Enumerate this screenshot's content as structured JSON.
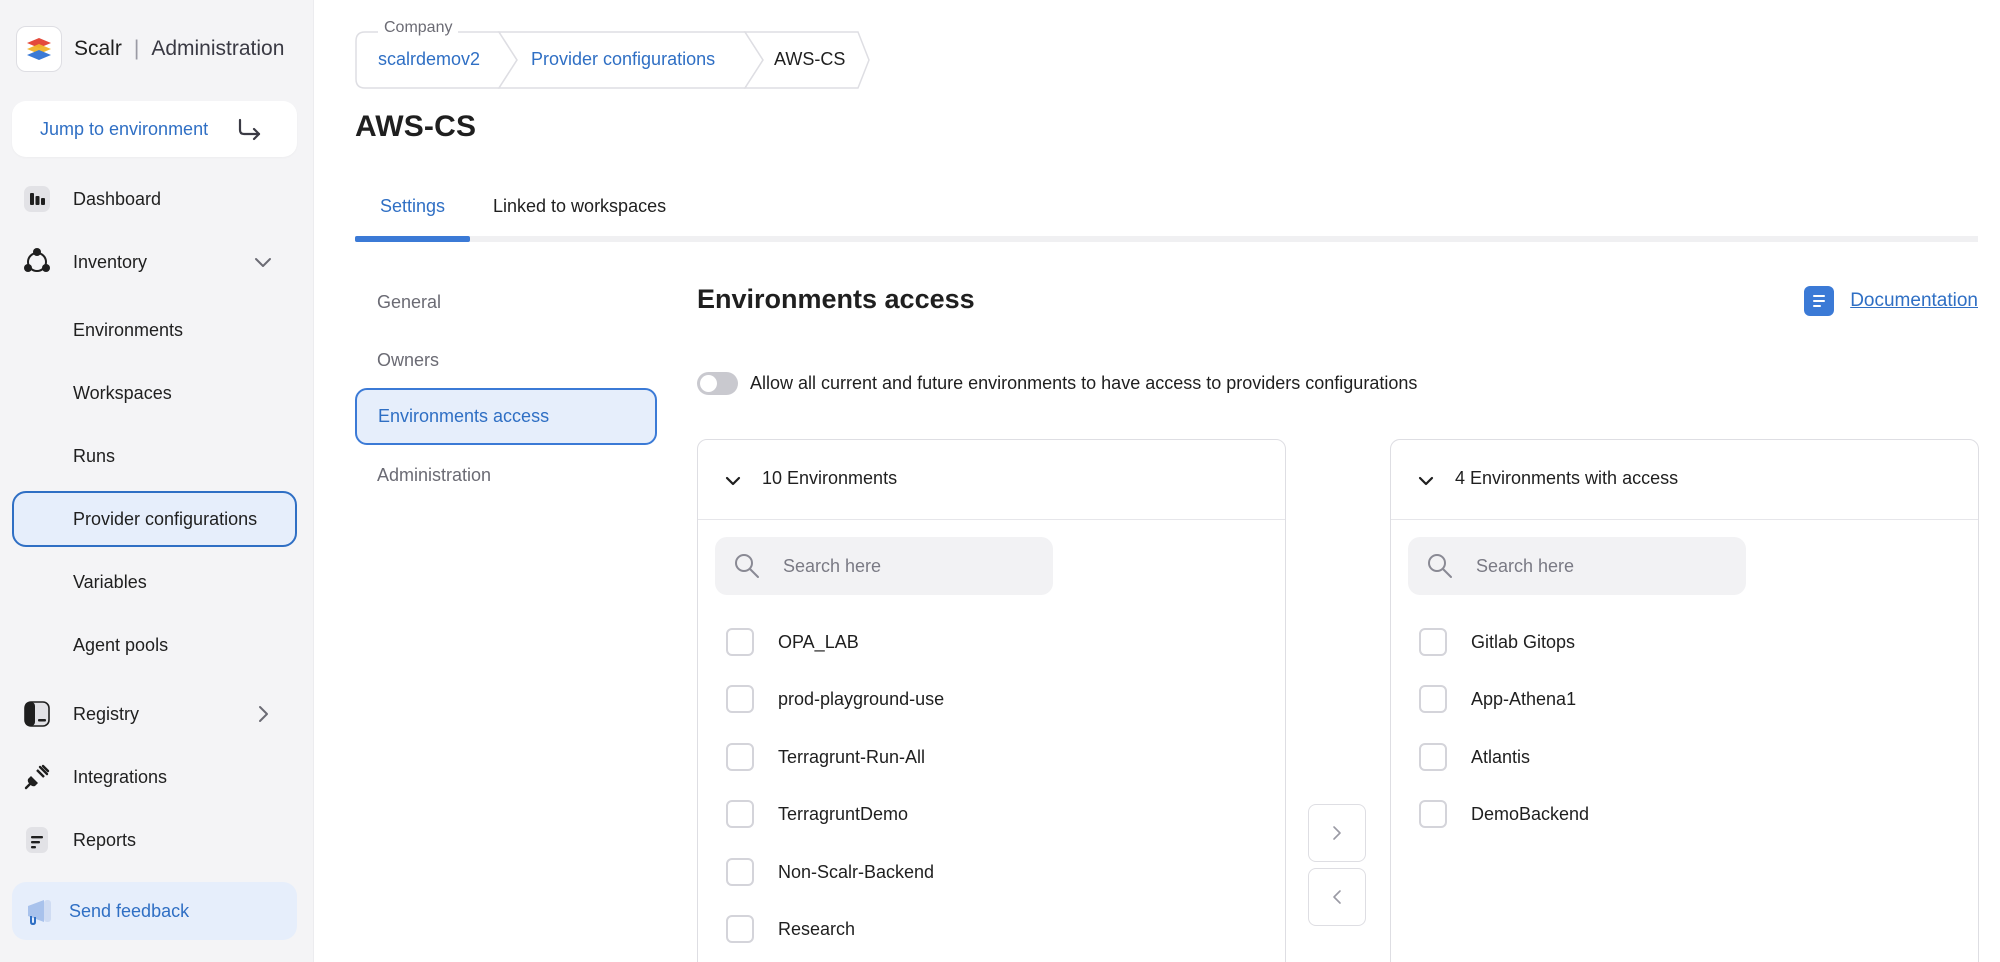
{
  "app": {
    "name": "Scalr",
    "section": "Administration"
  },
  "sidebar": {
    "jump_label": "Jump to environment",
    "items": [
      {
        "label": "Dashboard",
        "icon": "dashboard-icon"
      },
      {
        "label": "Inventory",
        "icon": "inventory-icon",
        "expanded": true
      },
      {
        "label": "Environments"
      },
      {
        "label": "Workspaces"
      },
      {
        "label": "Runs"
      },
      {
        "label": "Provider configurations",
        "active": true
      },
      {
        "label": "Variables"
      },
      {
        "label": "Agent pools"
      },
      {
        "label": "Registry",
        "icon": "registry-icon"
      },
      {
        "label": "Integrations",
        "icon": "plug-icon"
      },
      {
        "label": "Reports",
        "icon": "reports-icon"
      }
    ],
    "feedback_label": "Send feedback"
  },
  "breadcrumb": {
    "company_caption": "Company",
    "company": "scalrdemov2",
    "section": "Provider configurations",
    "current": "AWS-CS"
  },
  "page": {
    "title": "AWS-CS"
  },
  "tabs": [
    {
      "label": "Settings",
      "active": true
    },
    {
      "label": "Linked to workspaces"
    }
  ],
  "subnav": [
    {
      "label": "General"
    },
    {
      "label": "Owners"
    },
    {
      "label": "Environments access",
      "active": true
    },
    {
      "label": "Administration"
    }
  ],
  "env_access": {
    "title": "Environments access",
    "documentation": "Documentation",
    "toggle_label": "Allow all current and future environments to have access to providers configurations",
    "toggle_on": false,
    "left": {
      "header": "10 Environments",
      "search_placeholder": "Search here",
      "items": [
        "OPA_LAB",
        "prod-playground-use",
        "Terragrunt-Run-All",
        "TerragruntDemo",
        "Non-Scalr-Backend",
        "Research"
      ]
    },
    "right": {
      "header": "4 Environments with access",
      "search_placeholder": "Search here",
      "items": [
        "Gitlab Gitops",
        "App-Athena1",
        "Atlantis",
        "DemoBackend"
      ]
    }
  },
  "colors": {
    "accent": "#2f6fc4",
    "active_bg": "#e6eefb"
  }
}
